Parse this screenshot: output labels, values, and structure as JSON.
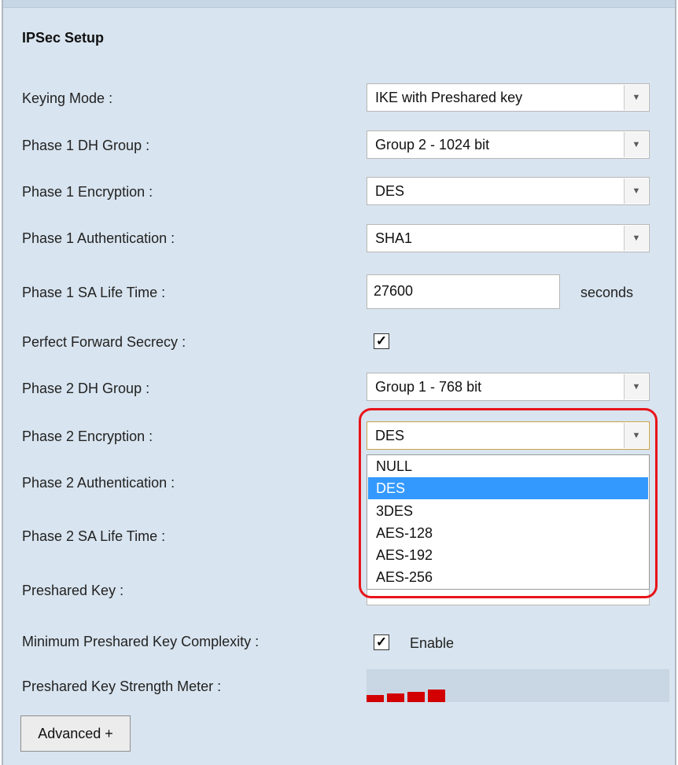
{
  "title": "IPSec Setup",
  "labels": {
    "keying_mode": "Keying Mode :",
    "p1_dh": "Phase 1 DH Group :",
    "p1_enc": "Phase 1 Encryption :",
    "p1_auth": "Phase 1 Authentication :",
    "p1_sa": "Phase 1 SA Life Time :",
    "pfs": "Perfect Forward Secrecy :",
    "p2_dh": "Phase 2 DH Group :",
    "p2_enc": "Phase 2 Encryption :",
    "p2_auth": "Phase 2 Authentication :",
    "p2_sa": "Phase 2 SA Life Time :",
    "psk": "Preshared Key :",
    "min_psk": "Minimum Preshared Key Complexity :",
    "psk_meter": "Preshared Key Strength Meter :"
  },
  "values": {
    "keying_mode": "IKE with Preshared key",
    "p1_dh": "Group 2 - 1024 bit",
    "p1_enc": "DES",
    "p1_auth": "SHA1",
    "p1_sa": "27600",
    "p1_sa_unit": "seconds",
    "p2_dh": "Group 1 - 768 bit",
    "p2_enc": "DES",
    "enable": "Enable"
  },
  "checkbox_mark": "✓",
  "dropdown_arrow": "▼",
  "p2_enc_options": [
    "NULL",
    "DES",
    "3DES",
    "AES-128",
    "AES-192",
    "AES-256"
  ],
  "p2_enc_selected_index": 1,
  "strength_meter_level": 4,
  "advanced_button": "Advanced +",
  "colors": {
    "highlight_ring": "#e8141a",
    "selected_option": "#3399ff",
    "meter": "#d20000"
  }
}
